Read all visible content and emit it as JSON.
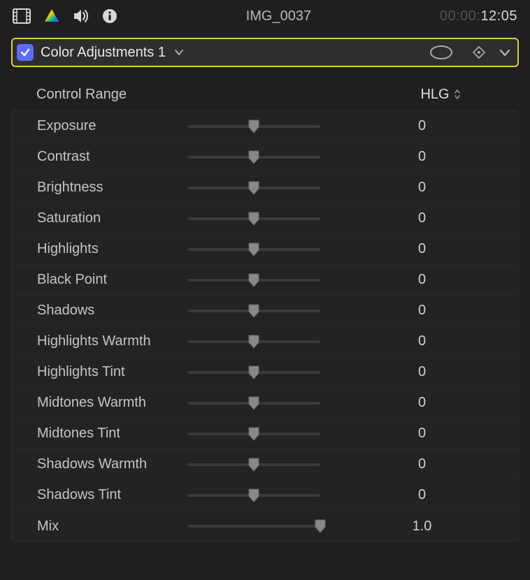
{
  "toolbar": {
    "clip_name": "IMG_0037",
    "timecode_dim": "00:00:",
    "timecode_em": "12:05"
  },
  "effect": {
    "name": "Color Adjustments 1"
  },
  "control_range": {
    "label": "Control Range",
    "value": "HLG"
  },
  "params": [
    {
      "label": "Exposure",
      "value": "0",
      "pos": 50
    },
    {
      "label": "Contrast",
      "value": "0",
      "pos": 50
    },
    {
      "label": "Brightness",
      "value": "0",
      "pos": 50
    },
    {
      "label": "Saturation",
      "value": "0",
      "pos": 50
    },
    {
      "label": "Highlights",
      "value": "0",
      "pos": 50
    },
    {
      "label": "Black Point",
      "value": "0",
      "pos": 50
    },
    {
      "label": "Shadows",
      "value": "0",
      "pos": 50
    },
    {
      "label": "Highlights Warmth",
      "value": "0",
      "pos": 50
    },
    {
      "label": "Highlights Tint",
      "value": "0",
      "pos": 50
    },
    {
      "label": "Midtones Warmth",
      "value": "0",
      "pos": 50
    },
    {
      "label": "Midtones Tint",
      "value": "0",
      "pos": 50
    },
    {
      "label": "Shadows Warmth",
      "value": "0",
      "pos": 50
    },
    {
      "label": "Shadows Tint",
      "value": "0",
      "pos": 50
    },
    {
      "label": "Mix",
      "value": "1.0",
      "pos": 100
    }
  ]
}
